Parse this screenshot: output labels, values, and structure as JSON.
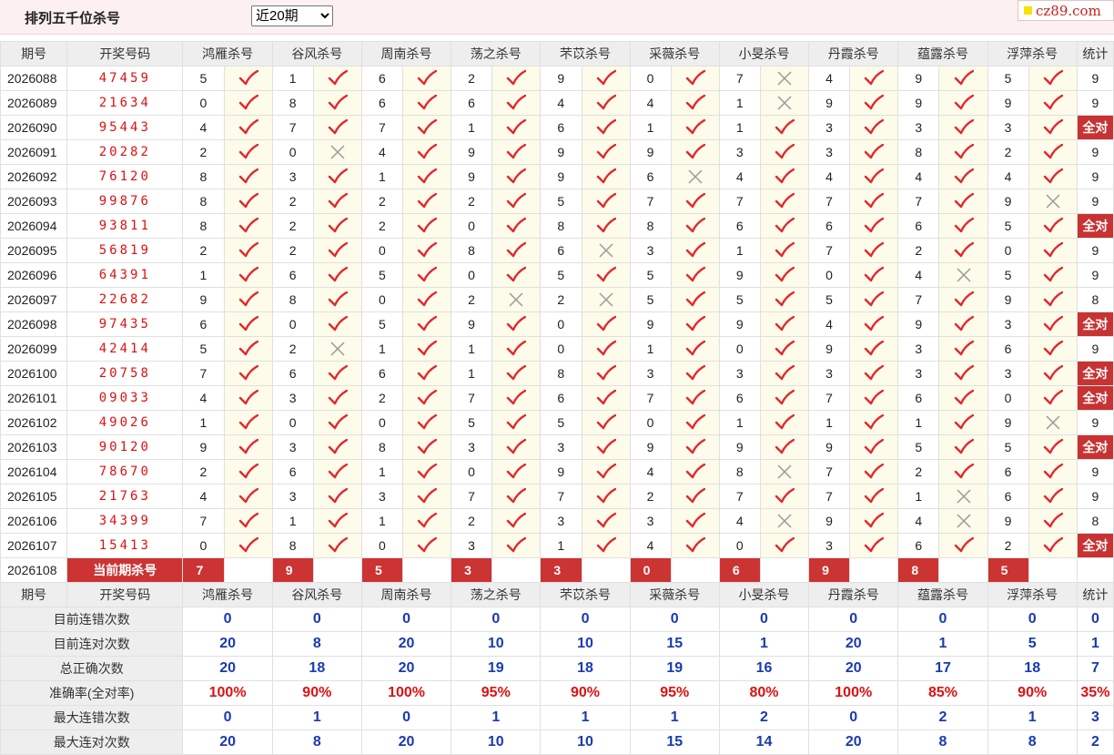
{
  "page_title": "排列五千位杀号",
  "period_select": {
    "value": "近20期",
    "options": [
      "近20期"
    ]
  },
  "site_badge": "cz89.com",
  "header": [
    "期号",
    "开奖号码",
    "鸿雁杀号",
    "谷风杀号",
    "周南杀号",
    "荡之杀号",
    "芣苡杀号",
    "采薇杀号",
    "小旻杀号",
    "丹霞杀号",
    "蕴露杀号",
    "浮萍杀号",
    "统计"
  ],
  "rows": [
    {
      "issue": "2026088",
      "winning": "47459",
      "kills": [
        [
          "5",
          "✓"
        ],
        [
          "1",
          "✓"
        ],
        [
          "6",
          "✓"
        ],
        [
          "2",
          "✓"
        ],
        [
          "9",
          "✓"
        ],
        [
          "0",
          "✓"
        ],
        [
          "7",
          "✗"
        ],
        [
          "4",
          "✓"
        ],
        [
          "9",
          "✓"
        ],
        [
          "5",
          "✓"
        ]
      ],
      "stat": "9"
    },
    {
      "issue": "2026089",
      "winning": "21634",
      "kills": [
        [
          "0",
          "✓"
        ],
        [
          "8",
          "✓"
        ],
        [
          "6",
          "✓"
        ],
        [
          "6",
          "✓"
        ],
        [
          "4",
          "✓"
        ],
        [
          "4",
          "✓"
        ],
        [
          "1",
          "✗"
        ],
        [
          "9",
          "✓"
        ],
        [
          "9",
          "✓"
        ],
        [
          "9",
          "✓"
        ]
      ],
      "stat": "9"
    },
    {
      "issue": "2026090",
      "winning": "95443",
      "kills": [
        [
          "4",
          "✓"
        ],
        [
          "7",
          "✓"
        ],
        [
          "7",
          "✓"
        ],
        [
          "1",
          "✓"
        ],
        [
          "6",
          "✓"
        ],
        [
          "1",
          "✓"
        ],
        [
          "1",
          "✓"
        ],
        [
          "3",
          "✓"
        ],
        [
          "3",
          "✓"
        ],
        [
          "3",
          "✓"
        ]
      ],
      "stat": "全对"
    },
    {
      "issue": "2026091",
      "winning": "20282",
      "kills": [
        [
          "2",
          "✓"
        ],
        [
          "0",
          "✗"
        ],
        [
          "4",
          "✓"
        ],
        [
          "9",
          "✓"
        ],
        [
          "9",
          "✓"
        ],
        [
          "9",
          "✓"
        ],
        [
          "3",
          "✓"
        ],
        [
          "3",
          "✓"
        ],
        [
          "8",
          "✓"
        ],
        [
          "2",
          "✓"
        ]
      ],
      "stat": "9"
    },
    {
      "issue": "2026092",
      "winning": "76120",
      "kills": [
        [
          "8",
          "✓"
        ],
        [
          "3",
          "✓"
        ],
        [
          "1",
          "✓"
        ],
        [
          "9",
          "✓"
        ],
        [
          "9",
          "✓"
        ],
        [
          "6",
          "✗"
        ],
        [
          "4",
          "✓"
        ],
        [
          "4",
          "✓"
        ],
        [
          "4",
          "✓"
        ],
        [
          "4",
          "✓"
        ]
      ],
      "stat": "9"
    },
    {
      "issue": "2026093",
      "winning": "99876",
      "kills": [
        [
          "8",
          "✓"
        ],
        [
          "2",
          "✓"
        ],
        [
          "2",
          "✓"
        ],
        [
          "2",
          "✓"
        ],
        [
          "5",
          "✓"
        ],
        [
          "7",
          "✓"
        ],
        [
          "7",
          "✓"
        ],
        [
          "7",
          "✓"
        ],
        [
          "7",
          "✓"
        ],
        [
          "9",
          "✗"
        ]
      ],
      "stat": "9"
    },
    {
      "issue": "2026094",
      "winning": "93811",
      "kills": [
        [
          "8",
          "✓"
        ],
        [
          "2",
          "✓"
        ],
        [
          "2",
          "✓"
        ],
        [
          "0",
          "✓"
        ],
        [
          "8",
          "✓"
        ],
        [
          "8",
          "✓"
        ],
        [
          "6",
          "✓"
        ],
        [
          "6",
          "✓"
        ],
        [
          "6",
          "✓"
        ],
        [
          "5",
          "✓"
        ]
      ],
      "stat": "全对"
    },
    {
      "issue": "2026095",
      "winning": "56819",
      "kills": [
        [
          "2",
          "✓"
        ],
        [
          "2",
          "✓"
        ],
        [
          "0",
          "✓"
        ],
        [
          "8",
          "✓"
        ],
        [
          "6",
          "✗"
        ],
        [
          "3",
          "✓"
        ],
        [
          "1",
          "✓"
        ],
        [
          "7",
          "✓"
        ],
        [
          "2",
          "✓"
        ],
        [
          "0",
          "✓"
        ]
      ],
      "stat": "9"
    },
    {
      "issue": "2026096",
      "winning": "64391",
      "kills": [
        [
          "1",
          "✓"
        ],
        [
          "6",
          "✓"
        ],
        [
          "5",
          "✓"
        ],
        [
          "0",
          "✓"
        ],
        [
          "5",
          "✓"
        ],
        [
          "5",
          "✓"
        ],
        [
          "9",
          "✓"
        ],
        [
          "0",
          "✓"
        ],
        [
          "4",
          "✗"
        ],
        [
          "5",
          "✓"
        ]
      ],
      "stat": "9"
    },
    {
      "issue": "2026097",
      "winning": "22682",
      "kills": [
        [
          "9",
          "✓"
        ],
        [
          "8",
          "✓"
        ],
        [
          "0",
          "✓"
        ],
        [
          "2",
          "✗"
        ],
        [
          "2",
          "✗"
        ],
        [
          "5",
          "✓"
        ],
        [
          "5",
          "✓"
        ],
        [
          "5",
          "✓"
        ],
        [
          "7",
          "✓"
        ],
        [
          "9",
          "✓"
        ]
      ],
      "stat": "8"
    },
    {
      "issue": "2026098",
      "winning": "97435",
      "kills": [
        [
          "6",
          "✓"
        ],
        [
          "0",
          "✓"
        ],
        [
          "5",
          "✓"
        ],
        [
          "9",
          "✓"
        ],
        [
          "0",
          "✓"
        ],
        [
          "9",
          "✓"
        ],
        [
          "9",
          "✓"
        ],
        [
          "4",
          "✓"
        ],
        [
          "9",
          "✓"
        ],
        [
          "3",
          "✓"
        ]
      ],
      "stat": "全对"
    },
    {
      "issue": "2026099",
      "winning": "42414",
      "kills": [
        [
          "5",
          "✓"
        ],
        [
          "2",
          "✗"
        ],
        [
          "1",
          "✓"
        ],
        [
          "1",
          "✓"
        ],
        [
          "0",
          "✓"
        ],
        [
          "1",
          "✓"
        ],
        [
          "0",
          "✓"
        ],
        [
          "9",
          "✓"
        ],
        [
          "3",
          "✓"
        ],
        [
          "6",
          "✓"
        ]
      ],
      "stat": "9"
    },
    {
      "issue": "2026100",
      "winning": "20758",
      "kills": [
        [
          "7",
          "✓"
        ],
        [
          "6",
          "✓"
        ],
        [
          "6",
          "✓"
        ],
        [
          "1",
          "✓"
        ],
        [
          "8",
          "✓"
        ],
        [
          "3",
          "✓"
        ],
        [
          "3",
          "✓"
        ],
        [
          "3",
          "✓"
        ],
        [
          "3",
          "✓"
        ],
        [
          "3",
          "✓"
        ]
      ],
      "stat": "全对"
    },
    {
      "issue": "2026101",
      "winning": "09033",
      "kills": [
        [
          "4",
          "✓"
        ],
        [
          "3",
          "✓"
        ],
        [
          "2",
          "✓"
        ],
        [
          "7",
          "✓"
        ],
        [
          "6",
          "✓"
        ],
        [
          "7",
          "✓"
        ],
        [
          "6",
          "✓"
        ],
        [
          "7",
          "✓"
        ],
        [
          "6",
          "✓"
        ],
        [
          "0",
          "✓"
        ]
      ],
      "stat": "全对"
    },
    {
      "issue": "2026102",
      "winning": "49026",
      "kills": [
        [
          "1",
          "✓"
        ],
        [
          "0",
          "✓"
        ],
        [
          "0",
          "✓"
        ],
        [
          "5",
          "✓"
        ],
        [
          "5",
          "✓"
        ],
        [
          "0",
          "✓"
        ],
        [
          "1",
          "✓"
        ],
        [
          "1",
          "✓"
        ],
        [
          "1",
          "✓"
        ],
        [
          "9",
          "✗"
        ]
      ],
      "stat": "9"
    },
    {
      "issue": "2026103",
      "winning": "90120",
      "kills": [
        [
          "9",
          "✓"
        ],
        [
          "3",
          "✓"
        ],
        [
          "8",
          "✓"
        ],
        [
          "3",
          "✓"
        ],
        [
          "3",
          "✓"
        ],
        [
          "9",
          "✓"
        ],
        [
          "9",
          "✓"
        ],
        [
          "9",
          "✓"
        ],
        [
          "5",
          "✓"
        ],
        [
          "5",
          "✓"
        ]
      ],
      "stat": "全对"
    },
    {
      "issue": "2026104",
      "winning": "78670",
      "kills": [
        [
          "2",
          "✓"
        ],
        [
          "6",
          "✓"
        ],
        [
          "1",
          "✓"
        ],
        [
          "0",
          "✓"
        ],
        [
          "9",
          "✓"
        ],
        [
          "4",
          "✓"
        ],
        [
          "8",
          "✗"
        ],
        [
          "7",
          "✓"
        ],
        [
          "2",
          "✓"
        ],
        [
          "6",
          "✓"
        ]
      ],
      "stat": "9"
    },
    {
      "issue": "2026105",
      "winning": "21763",
      "kills": [
        [
          "4",
          "✓"
        ],
        [
          "3",
          "✓"
        ],
        [
          "3",
          "✓"
        ],
        [
          "7",
          "✓"
        ],
        [
          "7",
          "✓"
        ],
        [
          "2",
          "✓"
        ],
        [
          "7",
          "✓"
        ],
        [
          "7",
          "✓"
        ],
        [
          "1",
          "✗"
        ],
        [
          "6",
          "✓"
        ]
      ],
      "stat": "9"
    },
    {
      "issue": "2026106",
      "winning": "34399",
      "kills": [
        [
          "7",
          "✓"
        ],
        [
          "1",
          "✓"
        ],
        [
          "1",
          "✓"
        ],
        [
          "2",
          "✓"
        ],
        [
          "3",
          "✓"
        ],
        [
          "3",
          "✓"
        ],
        [
          "4",
          "✗"
        ],
        [
          "9",
          "✓"
        ],
        [
          "4",
          "✗"
        ],
        [
          "9",
          "✓"
        ]
      ],
      "stat": "8"
    },
    {
      "issue": "2026107",
      "winning": "15413",
      "kills": [
        [
          "0",
          "✓"
        ],
        [
          "8",
          "✓"
        ],
        [
          "0",
          "✓"
        ],
        [
          "3",
          "✓"
        ],
        [
          "1",
          "✓"
        ],
        [
          "4",
          "✓"
        ],
        [
          "0",
          "✓"
        ],
        [
          "3",
          "✓"
        ],
        [
          "6",
          "✓"
        ],
        [
          "2",
          "✓"
        ]
      ],
      "stat": "全对"
    }
  ],
  "current": {
    "issue": "2026108",
    "label": "当前期杀号",
    "kills": [
      "7",
      "9",
      "5",
      "3",
      "3",
      "0",
      "6",
      "9",
      "8",
      "5"
    ]
  },
  "stats": [
    {
      "label": "目前连错次数",
      "values": [
        "0",
        "0",
        "0",
        "0",
        "0",
        "0",
        "0",
        "0",
        "0",
        "0",
        "0"
      ]
    },
    {
      "label": "目前连对次数",
      "values": [
        "20",
        "8",
        "20",
        "10",
        "10",
        "15",
        "1",
        "20",
        "1",
        "5",
        "1"
      ]
    },
    {
      "label": "总正确次数",
      "values": [
        "20",
        "18",
        "20",
        "19",
        "18",
        "19",
        "16",
        "20",
        "17",
        "18",
        "7"
      ]
    },
    {
      "label": "准确率(全对率)",
      "values": [
        "100%",
        "90%",
        "100%",
        "95%",
        "90%",
        "95%",
        "80%",
        "100%",
        "85%",
        "90%",
        "35%"
      ],
      "red": true
    },
    {
      "label": "最大连错次数",
      "values": [
        "0",
        "1",
        "0",
        "1",
        "1",
        "1",
        "2",
        "0",
        "2",
        "1",
        "3"
      ]
    },
    {
      "label": "最大连对次数",
      "values": [
        "20",
        "8",
        "20",
        "10",
        "10",
        "15",
        "14",
        "20",
        "8",
        "8",
        "2"
      ]
    }
  ]
}
